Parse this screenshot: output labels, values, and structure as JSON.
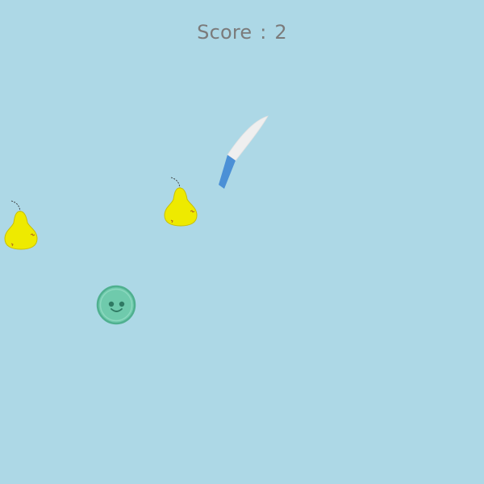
{
  "hud": {
    "score_label": "Score",
    "score_separator": ":",
    "score_value": "2"
  },
  "scene": {
    "background_color": "#add8e6",
    "pear_color": "#eeea00",
    "knife_blade_color": "#efefef",
    "knife_handle_color": "#4b90d6",
    "bomb_color": "#6fcaac"
  },
  "sprites": {
    "fruits": [
      {
        "type": "pear",
        "icon": "pear-icon"
      },
      {
        "type": "pear",
        "icon": "pear-icon"
      }
    ],
    "player": {
      "type": "knife",
      "icon": "knife-icon"
    },
    "enemy": {
      "type": "smiley-blob",
      "icon": "smiley-blob-icon"
    }
  }
}
